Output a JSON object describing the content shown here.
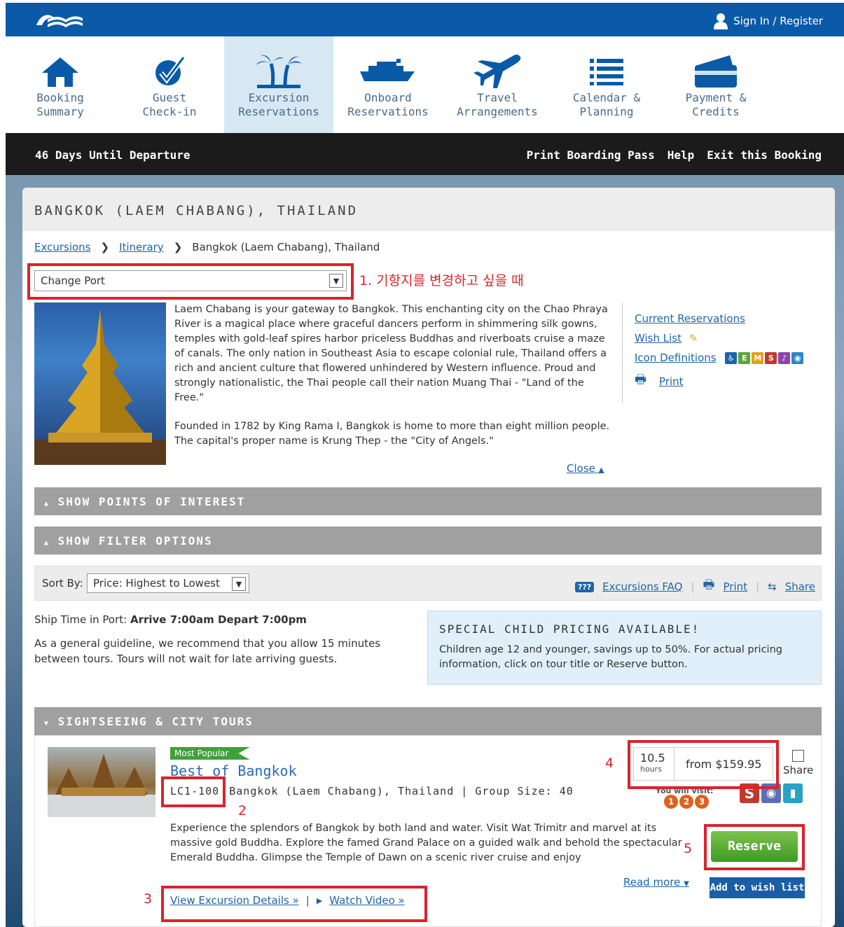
{
  "header": {
    "signin_label": "Sign In / Register",
    "brand_color": "#0a5aa8"
  },
  "nav": [
    {
      "label": "Booking\nSummary",
      "icon": "home-icon"
    },
    {
      "label": "Guest\nCheck-in",
      "icon": "checkmark-icon"
    },
    {
      "label": "Excursion\nReservations",
      "icon": "palm-tree-icon",
      "active": true
    },
    {
      "label": "Onboard\nReservations",
      "icon": "ship-icon"
    },
    {
      "label": "Travel\nArrangements",
      "icon": "airplane-icon"
    },
    {
      "label": "Calendar &\nPlanning",
      "icon": "list-icon"
    },
    {
      "label": "Payment &\nCredits",
      "icon": "wallet-icon"
    }
  ],
  "blackbar": {
    "departure": "46 Days Until Departure",
    "links": [
      "Print Boarding Pass",
      "Help",
      "Exit this Booking"
    ]
  },
  "port": {
    "title": "BANGKOK (LAEM CHABANG), THAILAND",
    "breadcrumb": [
      "Excursions",
      "Itinerary",
      "Bangkok (Laem Chabang), Thailand"
    ],
    "select_value": "Change Port",
    "annotation_1": "1. 기항지를 변경하고 싶을 때",
    "description_1": "Laem Chabang is your gateway to Bangkok. This enchanting city on the Chao Phraya River is a magical place where graceful dancers perform in shimmering silk gowns, temples with gold-leaf spires harbor priceless Buddhas and riverboats cruise a maze of canals. The only nation in Southeast Asia to escape colonial rule, Thailand offers a rich and ancient culture that flowered unhindered by Western influence. Proud and strongly nationalistic, the Thai people call their nation Muang Thai - \"Land of the Free.\"",
    "description_2": "Founded in 1782 by King Rama I, Bangkok is home to more than eight million people. The capital's proper name is Krung Thep - the \"City of Angels.\"",
    "side_links": {
      "current": "Current Reservations",
      "wishlist": "Wish List",
      "icon_defs": "Icon Definitions",
      "print": "Print"
    },
    "close_label": "Close"
  },
  "bars": {
    "points": "SHOW POINTS OF INTEREST",
    "filter": "SHOW FILTER OPTIONS",
    "category": "SIGHTSEEING & CITY TOURS"
  },
  "sort": {
    "label": "Sort By:",
    "value": "Price: Highest to Lowest",
    "faq": "Excursions FAQ",
    "print": "Print",
    "share": "Share"
  },
  "ship_info": {
    "label": "Ship Time in Port:",
    "times": "Arrive 7:00am Depart 7:00pm",
    "guideline": "As a general guideline, we recommend that you allow 15 minutes between tours. Tours will not wait for late arriving guests."
  },
  "child_pricing": {
    "title": "SPECIAL CHILD PRICING AVAILABLE!",
    "text": "Children age 12 and younger, savings up to 50%. For actual pricing information, click on tour title or Reserve button."
  },
  "tour": {
    "badge": "Most Popular",
    "title": "Best of Bangkok",
    "code": "LC1-100",
    "meta": "Bangkok (Laem Chabang), Thailand | Group Size: 40",
    "description": "Experience the splendors of Bangkok by both land and water. Visit Wat Trimitr and marvel at its massive gold Buddha. Explore the famed Grand Palace on a guided walk and behold the spectacular Emerald Buddha. Glimpse the Temple of Dawn on a scenic river cruise and enjoy",
    "hours_value": "10.5",
    "hours_unit": "hours",
    "price": "from $159.95",
    "share": "Share",
    "visit_label": "You will visit:",
    "visits": [
      "1",
      "2",
      "3"
    ],
    "read_more": "Read more",
    "reserve": "Reserve",
    "wishlist": "Add to wish list",
    "details_link": "View Excursion Details »",
    "video_link": "Watch Video »",
    "ann_2": "2",
    "ann_3": "3",
    "ann_4": "4",
    "ann_5": "5"
  }
}
